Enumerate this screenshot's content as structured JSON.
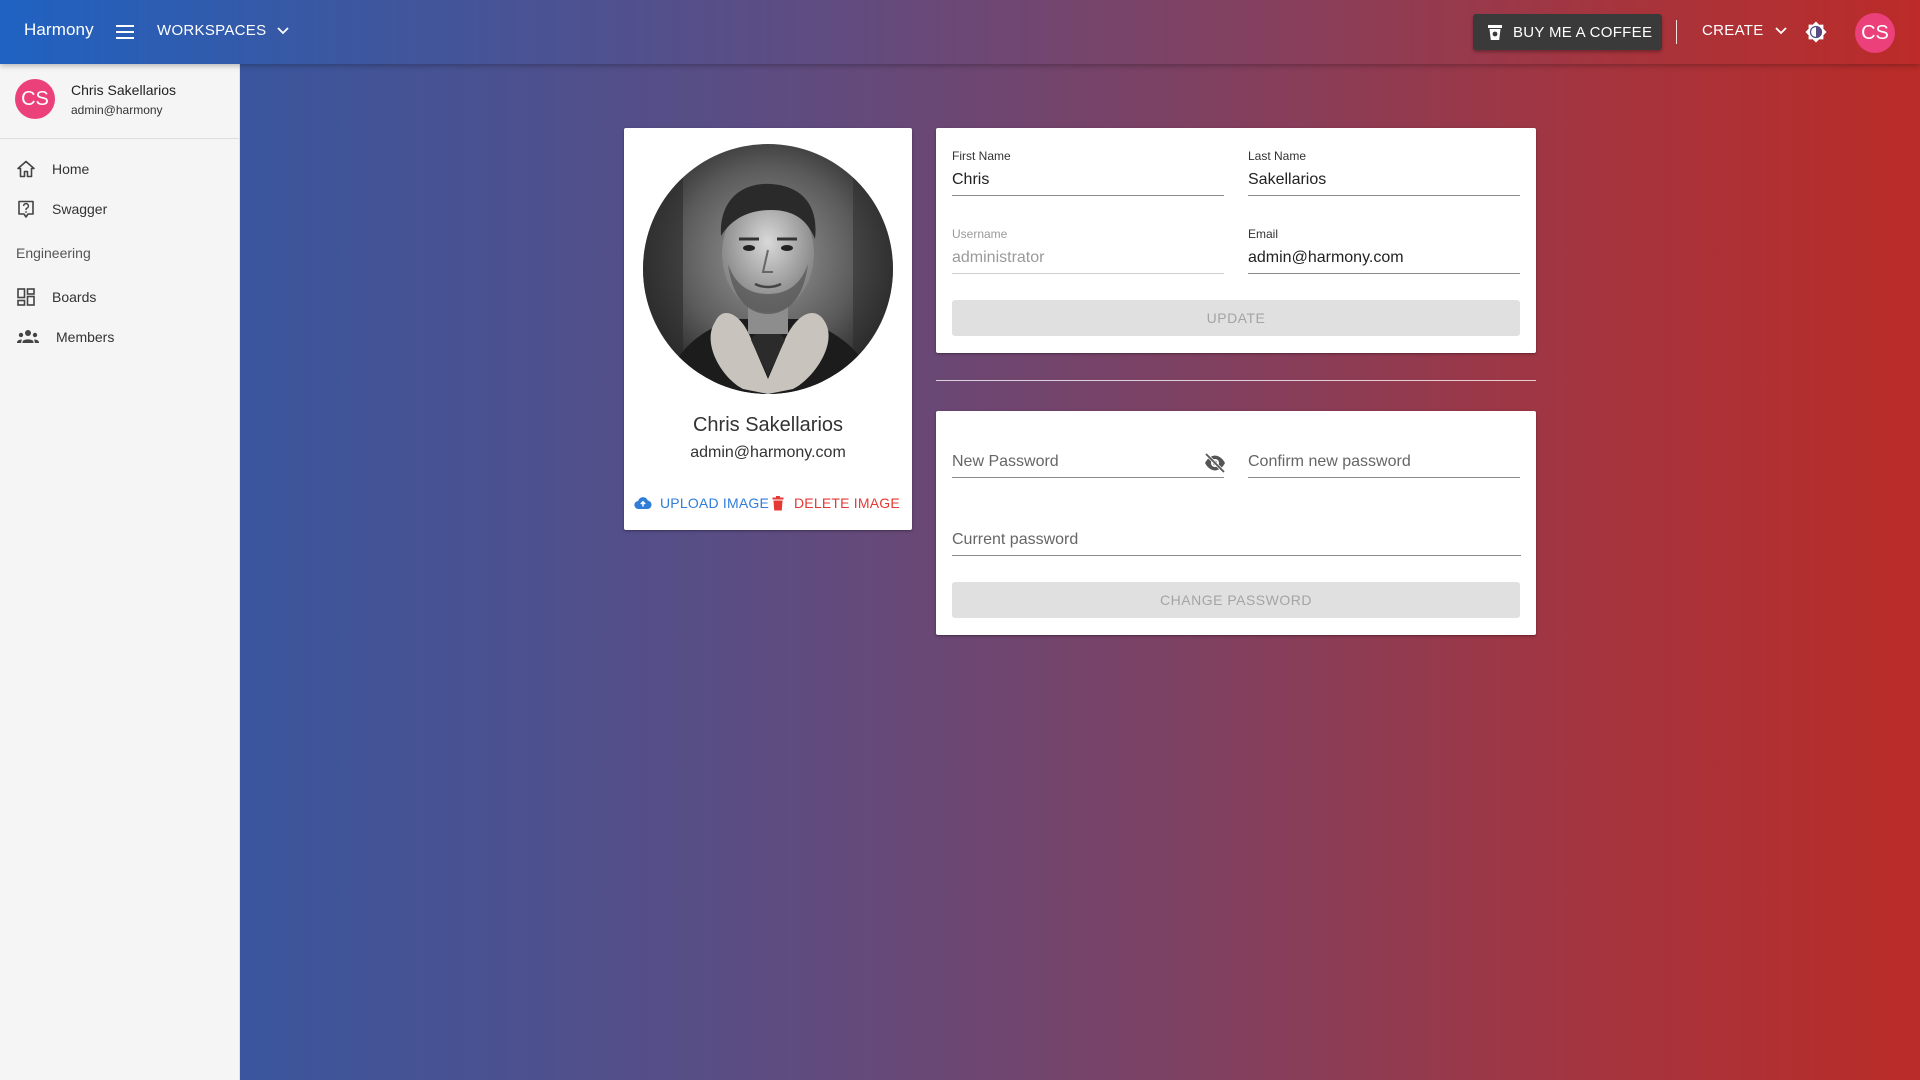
{
  "appbar": {
    "brand": "Harmony",
    "workspaces_label": "WORKSPACES",
    "coffee_label": "BUY ME A COFFEE",
    "create_label": "CREATE",
    "avatar_initials": "CS",
    "icons": [
      "menu-icon",
      "chevron-down-icon",
      "coffee-cup-icon",
      "brightness-icon"
    ]
  },
  "sidebar": {
    "user": {
      "initials": "CS",
      "name": "Chris Sakellarios",
      "email": "admin@harmony"
    },
    "items": [
      {
        "label": "Home",
        "icon": "home-icon"
      },
      {
        "label": "Swagger",
        "icon": "help-box-icon"
      }
    ],
    "section_header": "Engineering",
    "section_items": [
      {
        "label": "Boards",
        "icon": "dashboard-icon"
      },
      {
        "label": "Members",
        "icon": "people-icon"
      }
    ]
  },
  "profile": {
    "name": "Chris Sakellarios",
    "email": "admin@harmony.com",
    "upload_label": "UPLOAD IMAGE",
    "delete_label": "DELETE IMAGE"
  },
  "info_form": {
    "first_name_label": "First Name",
    "first_name_value": "Chris",
    "last_name_label": "Last Name",
    "last_name_value": "Sakellarios",
    "username_label": "Username",
    "username_value": "administrator",
    "email_label": "Email",
    "email_value": "admin@harmony.com",
    "update_label": "UPDATE"
  },
  "password_form": {
    "new_password_placeholder": "New Password",
    "confirm_password_placeholder": "Confirm new password",
    "current_password_placeholder": "Current password",
    "change_label": "CHANGE PASSWORD"
  },
  "colors": {
    "avatar": "#ec407a",
    "upload": "#2f7dd8",
    "delete": "#e53935",
    "coffee_button": "#3a3a3a"
  }
}
